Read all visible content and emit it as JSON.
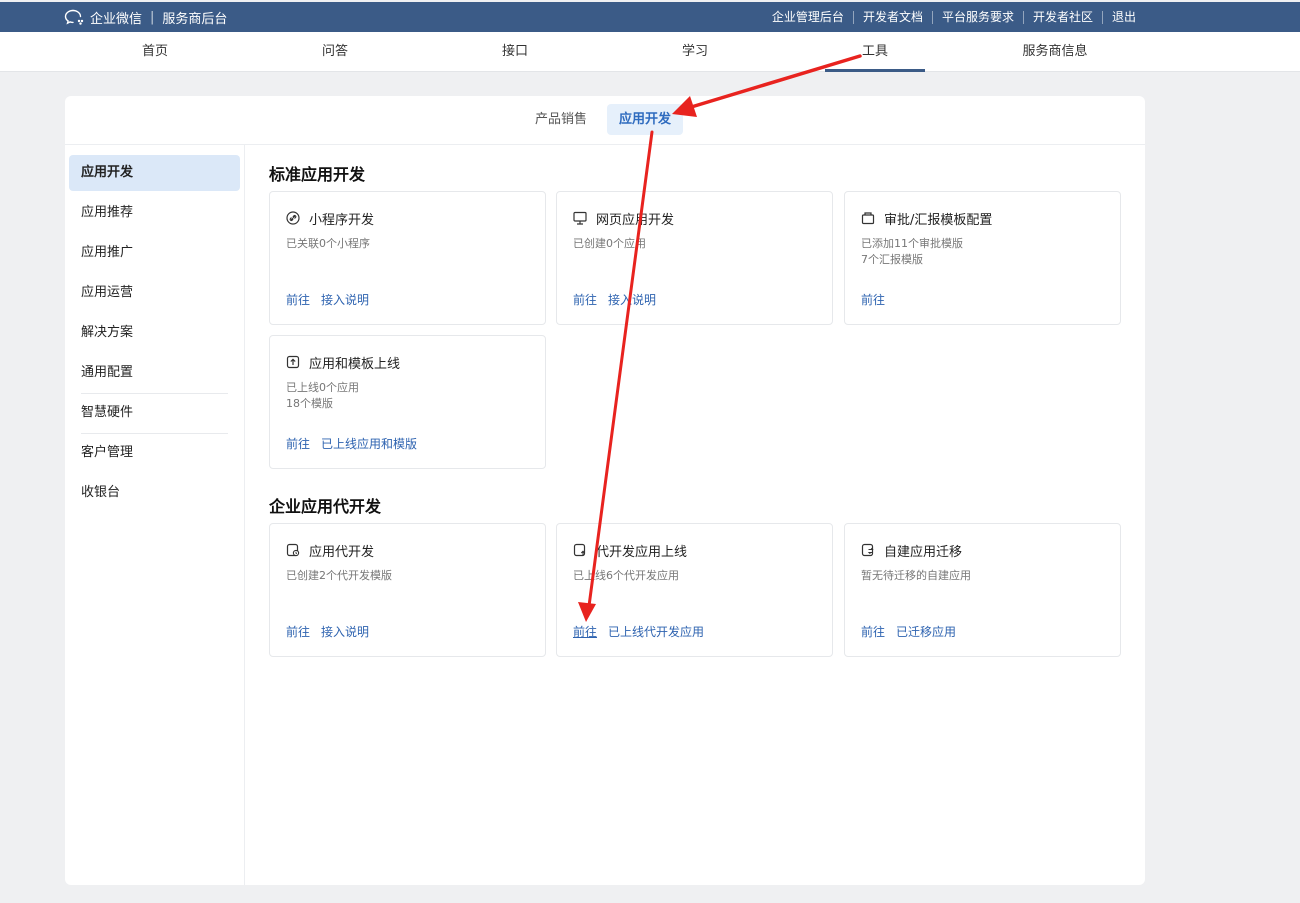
{
  "brand": {
    "name": "企业微信",
    "subtitle": "服务商后台"
  },
  "toplinks": [
    "企业管理后台",
    "开发者文档",
    "平台服务要求",
    "开发者社区",
    "退出"
  ],
  "mainnav": [
    "首页",
    "问答",
    "接口",
    "学习",
    "工具",
    "服务商信息"
  ],
  "mainnav_active": "工具",
  "subtabs": [
    "产品销售",
    "应用开发"
  ],
  "subtab_active": "应用开发",
  "sidebar": [
    "应用开发",
    "应用推荐",
    "应用推广",
    "应用运营",
    "解决方案",
    "通用配置",
    "智慧硬件",
    "客户管理",
    "收银台"
  ],
  "sidebar_active": "应用开发",
  "sections": [
    {
      "title": "标准应用开发",
      "cards": [
        {
          "icon": "link-icon",
          "title": "小程序开发",
          "desc": [
            "已关联0个小程序"
          ],
          "links": [
            "前往",
            "接入说明"
          ]
        },
        {
          "icon": "monitor-icon",
          "title": "网页应用开发",
          "desc": [
            "已创建0个应用"
          ],
          "links": [
            "前往",
            "接入说明"
          ]
        },
        {
          "icon": "template-icon",
          "title": "审批/汇报模板配置",
          "desc": [
            "已添加11个审批模版",
            "7个汇报模版"
          ],
          "links": [
            "前往"
          ]
        },
        {
          "icon": "upload-icon",
          "title": "应用和模板上线",
          "desc": [
            "已上线0个应用",
            "18个模版"
          ],
          "links": [
            "前往",
            "已上线应用和模版"
          ]
        }
      ]
    },
    {
      "title": "企业应用代开发",
      "cards": [
        {
          "icon": "dev-icon",
          "title": "应用代开发",
          "desc": [
            "已创建2个代开发模版"
          ],
          "links": [
            "前往",
            "接入说明"
          ]
        },
        {
          "icon": "launch-icon",
          "title": "代开发应用上线",
          "desc": [
            "已上线6个代开发应用"
          ],
          "links": [
            "前往",
            "已上线代开发应用"
          ]
        },
        {
          "icon": "migrate-icon",
          "title": "自建应用迁移",
          "desc": [
            "暂无待迁移的自建应用"
          ],
          "links": [
            "前往",
            "已迁移应用"
          ]
        }
      ]
    }
  ],
  "colors": {
    "topbar": "#3b5b87",
    "accent": "#2e63b0",
    "annotation_arrow": "#e8231f"
  }
}
